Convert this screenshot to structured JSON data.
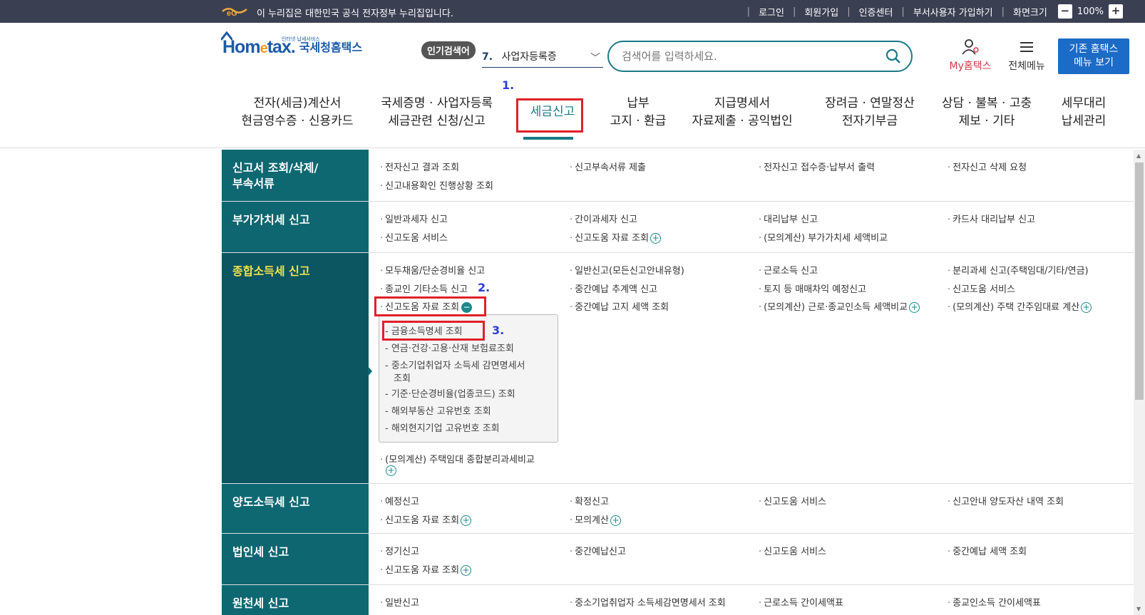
{
  "topbar": {
    "notice": "이 누리집은 대한민국 공식 전자정부 누리집입니다.",
    "links": [
      "로그인",
      "회원가입",
      "인증센터",
      "부서사용자 가입하기",
      "화면크기"
    ],
    "zoom": "100%",
    "zoom_minus": "−",
    "zoom_plus": "+"
  },
  "header": {
    "logo_small": "인터넷 납세서비스",
    "logo_main_a": "Hom",
    "logo_main_e": "e",
    "logo_main_b": "tax.",
    "logo_sub": "국세청홈택스",
    "popular_badge": "인기검색어",
    "popular_num": "7.",
    "popular_term": "사업자등록증",
    "search_placeholder": "검색어를 입력하세요.",
    "my_hometax": "My홈택스",
    "all_menu": "전체메뉴",
    "old_menu_line1": "기존 홈택스",
    "old_menu_line2": "메뉴 보기"
  },
  "gnb": [
    {
      "l1": "전자(세금)계산서",
      "l2": "현금영수증 · 신용카드"
    },
    {
      "l1": "국세증명 · 사업자등록",
      "l2": "세금관련 신청/신고"
    },
    {
      "l1": "세금신고",
      "l2": ""
    },
    {
      "l1": "납부",
      "l2": "고지 · 환급"
    },
    {
      "l1": "지급명세서",
      "l2": "자료제출 · 공익법인"
    },
    {
      "l1": "장려금 · 연말정산",
      "l2": "전자기부금"
    },
    {
      "l1": "상담 · 불복 · 고충",
      "l2": "제보 · 기타"
    },
    {
      "l1": "세무대리",
      "l2": "납세관리"
    }
  ],
  "annotations": {
    "a1": "1.",
    "a2": "2.",
    "a3": "3."
  },
  "sections": [
    {
      "title_l1": "신고서 조회/삭제/",
      "title_l2": "부속서류",
      "items": [
        "전자신고 결과 조회",
        "신고부속서류 제출",
        "전자신고 접수증·납부서 출력",
        "전자신고 삭제 요청",
        "신고내용확인 진행상황 조회"
      ]
    },
    {
      "title_l1": "부가가치세 신고",
      "title_l2": "",
      "items": [
        "일반과세자 신고",
        "간이과세자 신고",
        "대리납부 신고",
        "카드사 대리납부 신고",
        "신고도움 서비스",
        "신고도움 자료 조회",
        "(모의계산) 부가가치세 세액비교"
      ]
    },
    {
      "title_l1": "종합소득세 신고",
      "title_l2": "",
      "items": [
        "모두채움/단순경비율 신고",
        "일반신고(모든신고안내유형)",
        "근로소득 신고",
        "분리과세 신고(주택임대/기타/연금)",
        "종교인 기타소득 신고",
        "중간예납 추계액 신고",
        "토지 등 매매차익 예정신고",
        "신고도움 서비스",
        "신고도움 자료 조회",
        "중간예납 고지 세액 조회",
        "(모의계산) 근로·종교인소득 세액비교",
        "(모의계산) 주택 간주임대료 계산",
        "(모의계산) 주택임대 종합분리과세비교"
      ],
      "submenu": [
        "금융소득명세 조회",
        "연금·건강·고용·산재 보험료조회",
        "중소기업취업자 소득세 감면명세서",
        "조회",
        "기준·단순경비율(업종코드) 조회",
        "해외부동산 고유번호 조회",
        "해외현지기업 고유번호 조회"
      ]
    },
    {
      "title_l1": "양도소득세 신고",
      "title_l2": "",
      "items": [
        "예정신고",
        "확정신고",
        "신고도움 서비스",
        "신고안내 양도자산 내역 조회",
        "신고도움 자료 조회",
        "모의계산"
      ]
    },
    {
      "title_l1": "법인세 신고",
      "title_l2": "",
      "items": [
        "정기신고",
        "중간예납신고",
        "신고도움 서비스",
        "중간예납 세액 조회",
        "신고도움 자료 조회"
      ]
    },
    {
      "title_l1": "원천세 신고",
      "title_l2": "",
      "items": [
        "일반신고",
        "중소기업취업자 소득세감면명세서 조회",
        "근로소득 간이세액표",
        "종교인소득 간이세액표"
      ]
    }
  ],
  "colors": {
    "teal": "#0e6872",
    "accent": "#1a7a86",
    "red": "#e0202a",
    "blue": "#1c6bc6"
  }
}
